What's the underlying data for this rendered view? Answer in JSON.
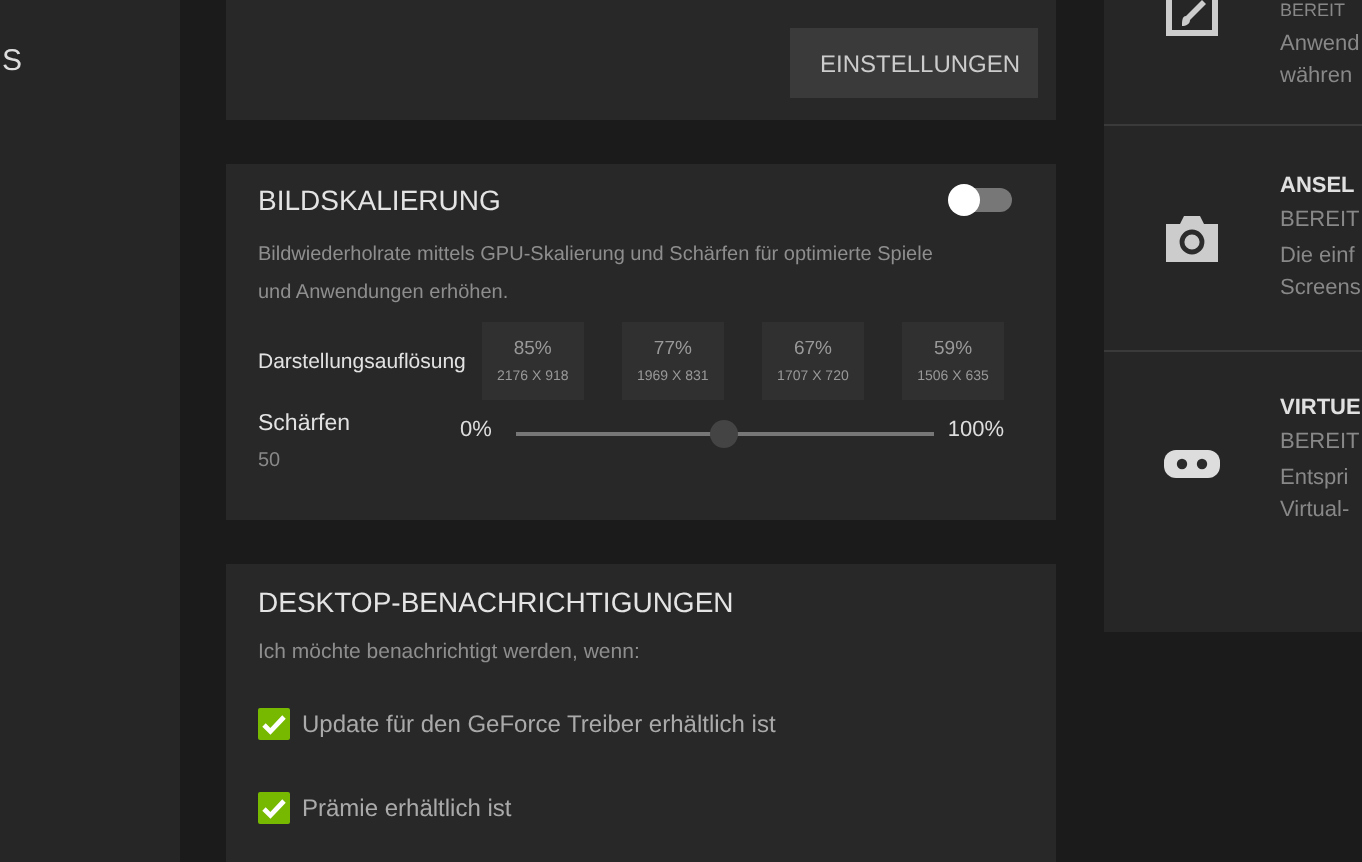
{
  "sidebar": {
    "items": [
      {
        "label": "S"
      }
    ]
  },
  "top_card": {
    "button": "EINSTELLUNGEN"
  },
  "scaling": {
    "title": "BILDSKALIERUNG",
    "on": false,
    "description": "Bildwiederholrate mittels GPU-Skalierung und Schärfen für optimierte Spiele und Anwendungen erhöhen.",
    "resolution_label": "Darstellungsauflösung",
    "resolutions": [
      {
        "percent": "85%",
        "size": "2176 X 918"
      },
      {
        "percent": "77%",
        "size": "1969 X 831"
      },
      {
        "percent": "67%",
        "size": "1707 X 720"
      },
      {
        "percent": "59%",
        "size": "1506 X 635"
      }
    ],
    "sharpen": {
      "label": "Schärfen",
      "value": "50",
      "min": "0%",
      "max": "100%",
      "level": 0.5
    }
  },
  "notifications": {
    "title": "DESKTOP-BENACHRICHTIGUNGEN",
    "intro": "Ich möchte benachrichtigt werden, wenn:",
    "options": [
      {
        "label": "Update für den GeForce Treiber erhältlich ist",
        "checked": true
      },
      {
        "label": "Prämie erhältlich ist",
        "checked": true
      }
    ]
  },
  "features": [
    {
      "kind": "paint",
      "status": "BEREIT",
      "description": [
        "Anwend",
        "währen"
      ]
    },
    {
      "kind": "camera",
      "title": "ANSEL",
      "status": "BEREIT",
      "description": [
        "Die einf",
        "Screens"
      ]
    },
    {
      "kind": "vr",
      "title": "VIRTUE",
      "status": "BEREIT",
      "description": [
        "Entspri",
        "Virtual-"
      ]
    }
  ]
}
